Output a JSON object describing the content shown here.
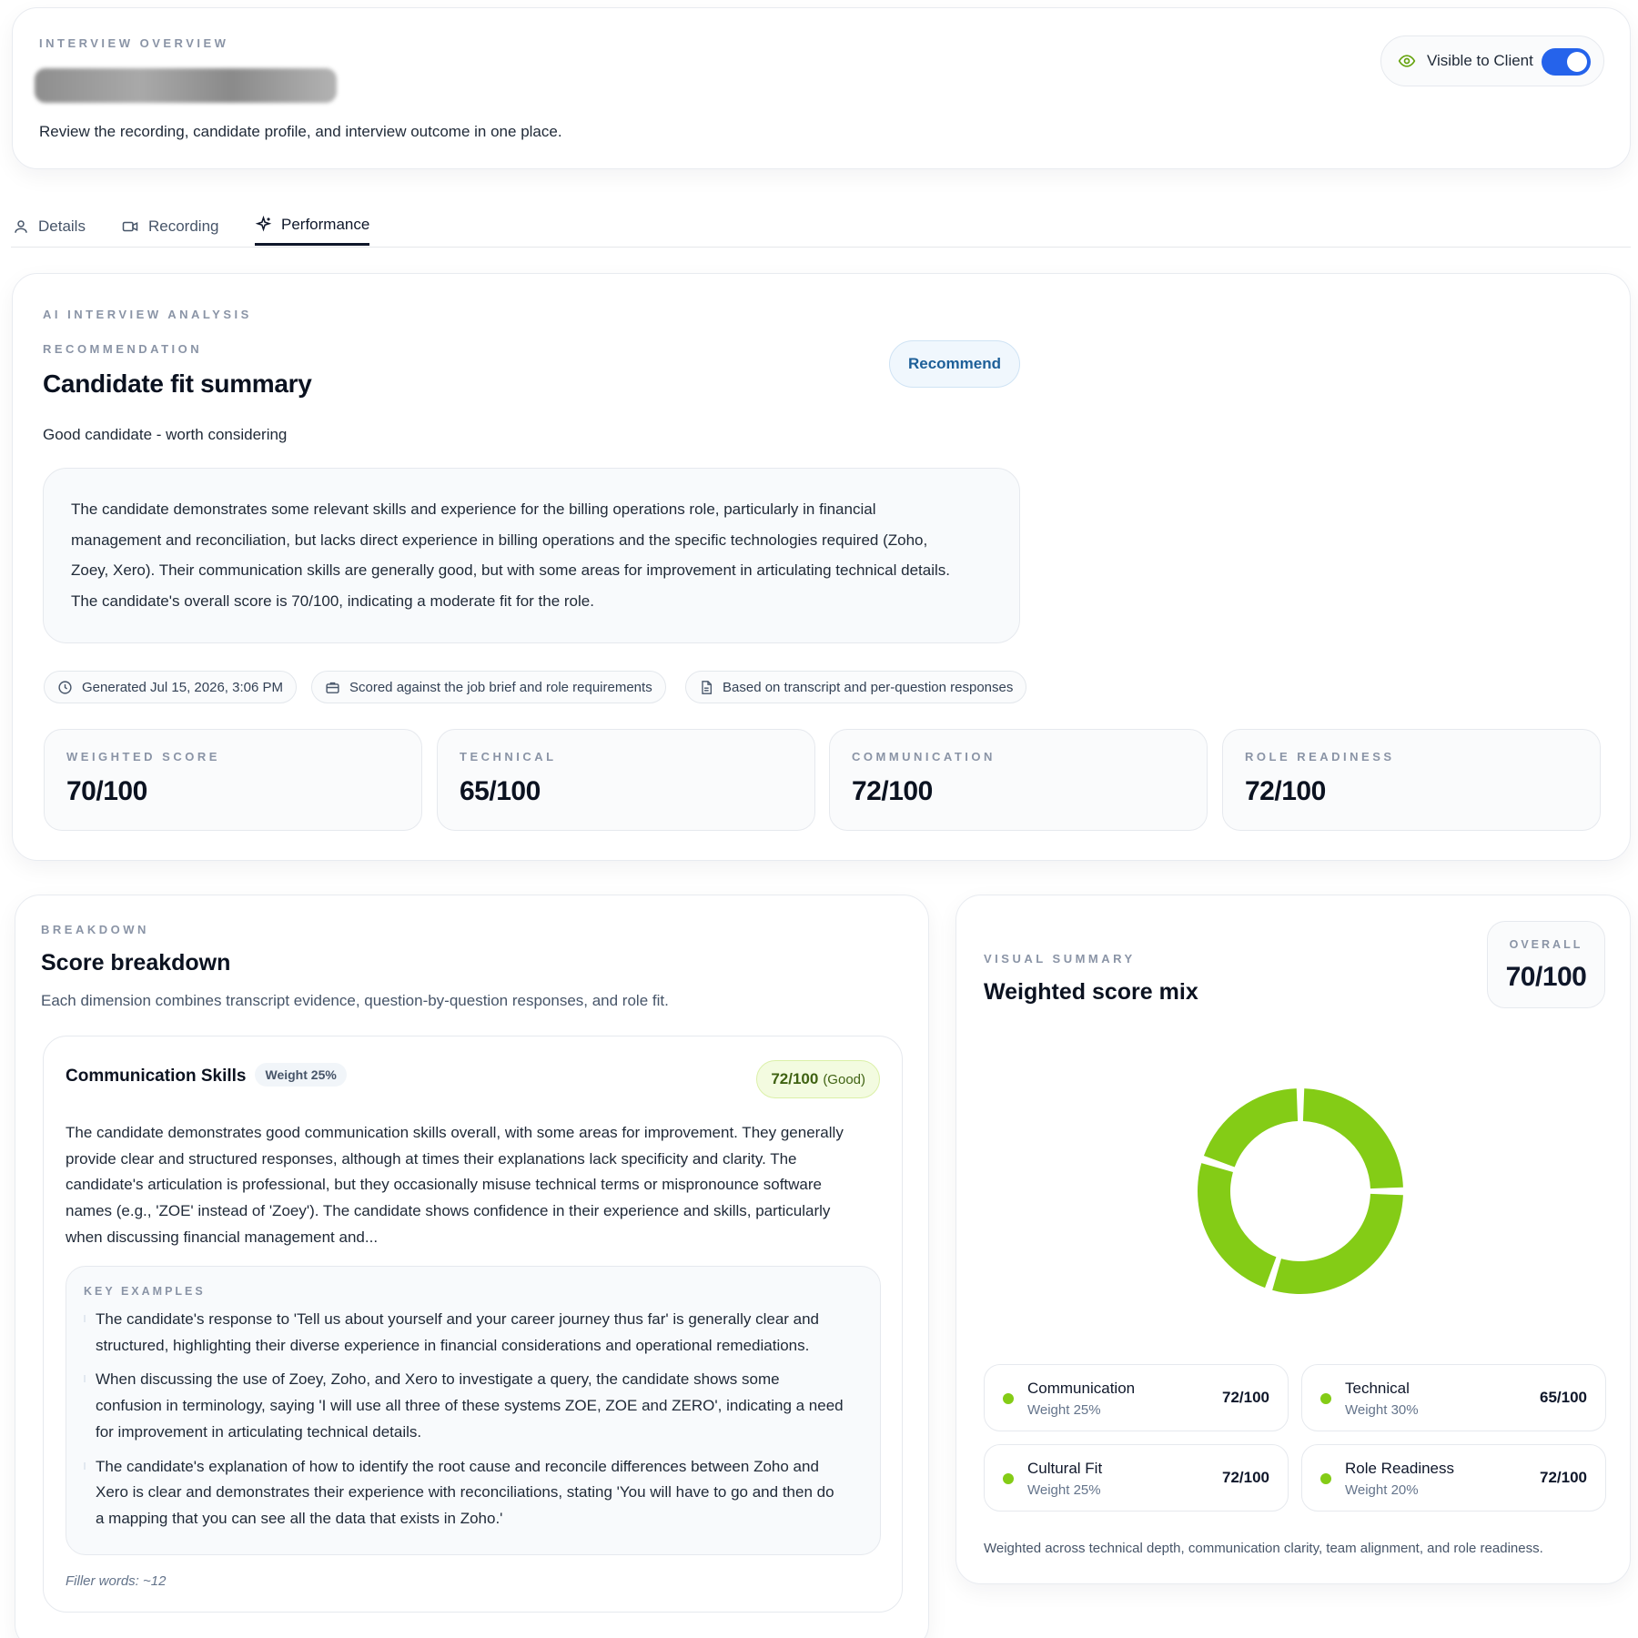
{
  "header": {
    "eyebrow": "INTERVIEW OVERVIEW",
    "subtitle": "Review the recording, candidate profile, and interview outcome in one place.",
    "visibility_label": "Visible to Client",
    "visibility_on": true
  },
  "tabs": [
    {
      "label": "Details",
      "icon": "user-icon"
    },
    {
      "label": "Recording",
      "icon": "video-icon"
    },
    {
      "label": "Performance",
      "icon": "sparkles-icon",
      "active": true
    }
  ],
  "analysis": {
    "eyebrow": "AI INTERVIEW ANALYSIS",
    "section_eyebrow": "RECOMMENDATION",
    "title": "Candidate fit summary",
    "verdict": "Good candidate - worth considering",
    "recommendation_badge": "Recommend",
    "summary_lines": [
      "The candidate demonstrates some relevant skills and experience for the billing operations role, particularly in financial",
      "management and reconciliation, but lacks direct experience in billing operations and the specific technologies required (Zoho,",
      "Zoey, Xero). Their communication skills are generally good, but with some areas for improvement in articulating technical details.",
      "The candidate's overall score is 70/100, indicating a moderate fit for the role."
    ],
    "chips": [
      {
        "label": "Generated Jul 15, 2026, 3:06 PM",
        "icon": "clock-icon"
      },
      {
        "label": "Scored against the job brief and role requirements",
        "icon": "briefcase-icon"
      },
      {
        "label": "Based on transcript and per-question responses",
        "icon": "document-icon"
      }
    ],
    "scores": [
      {
        "label": "WEIGHTED SCORE",
        "value": "70/100"
      },
      {
        "label": "TECHNICAL",
        "value": "65/100"
      },
      {
        "label": "COMMUNICATION",
        "value": "72/100"
      },
      {
        "label": "ROLE READINESS",
        "value": "72/100"
      }
    ]
  },
  "breakdown": {
    "eyebrow": "BREAKDOWN",
    "title": "Score breakdown",
    "description": "Each dimension combines transcript evidence, question-by-question responses, and role fit.",
    "dimension": {
      "name": "Communication Skills",
      "weight": "Weight 25%",
      "score": "72/100",
      "quality": "(Good)",
      "text_lines": [
        "The candidate demonstrates good communication skills overall, with some areas for improvement. They generally",
        "provide clear and structured responses, although at times their explanations lack specificity and clarity. The",
        "candidate's articulation is professional, but they occasionally misuse technical terms or mispronounce software",
        "names (e.g., 'ZOE' instead of 'Zoey'). The candidate shows confidence in their experience and skills, particularly",
        "when discussing financial management and..."
      ],
      "examples_eyebrow": "KEY EXAMPLES",
      "examples": [
        [
          "The candidate's response to 'Tell us about yourself and your career journey thus far' is generally clear and",
          "structured, highlighting their diverse experience in financial considerations and operational remediations."
        ],
        [
          "When discussing the use of Zoey, Zoho, and Xero to investigate a query, the candidate shows some",
          "confusion in terminology, saying 'I will use all three of these systems ZOE, ZOE and ZERO', indicating a need",
          "for improvement in articulating technical details."
        ],
        [
          "The candidate's explanation of how to identify the root cause and reconcile differences between Zoho and",
          "Xero is clear and demonstrates their experience with reconciliations, stating 'You will have to go and then do",
          "a mapping that you can see all the data that exists in Zoho.'"
        ]
      ],
      "filler": "Filler words: ~12"
    }
  },
  "visual_summary": {
    "eyebrow": "VISUAL SUMMARY",
    "title": "Weighted score mix",
    "overall_label": "OVERALL",
    "overall_value": "70/100",
    "footnote": "Weighted across technical depth, communication clarity, team alignment, and role readiness.",
    "accent": "#84cc16"
  },
  "chart_data": {
    "type": "pie",
    "categories": [
      "Communication",
      "Technical",
      "Cultural Fit",
      "Role Readiness"
    ],
    "weights": [
      25,
      30,
      25,
      20
    ],
    "scores": [
      "72/100",
      "65/100",
      "72/100",
      "72/100"
    ],
    "weight_labels": [
      "Weight 25%",
      "Weight 30%",
      "Weight 25%",
      "Weight 20%"
    ],
    "donut": true,
    "color": "#84cc16"
  }
}
